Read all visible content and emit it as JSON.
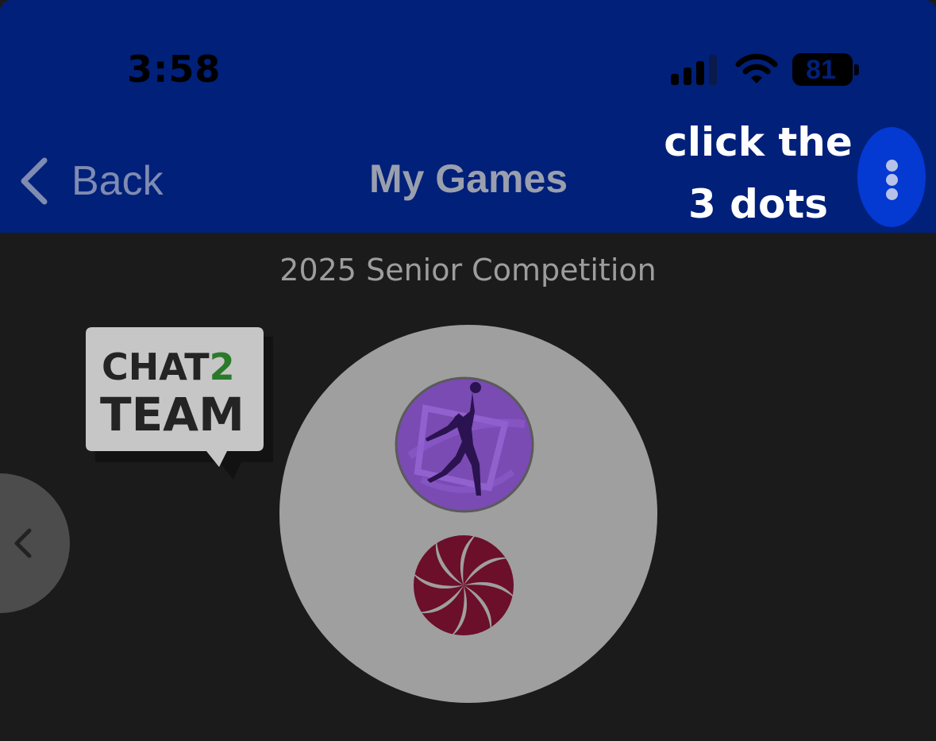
{
  "status_bar": {
    "time": "3:58",
    "battery_level": "81",
    "signal_bars_active": 3,
    "signal_bars_total": 4,
    "icons": [
      "signal-icon",
      "wifi-icon",
      "battery-icon"
    ]
  },
  "nav": {
    "back_label": "Back",
    "title": "My Games",
    "back_icon": "chevron-left-icon",
    "menu_icon": "more-vertical-icon"
  },
  "hint": {
    "line1": "click the",
    "line2": "3 dots"
  },
  "main": {
    "competition_name": "2025 Senior Competition",
    "chat_logo": {
      "word1_a": "CHAT",
      "word1_b": "2",
      "word2": "TEAM"
    },
    "prev_icon": "chevron-left-icon",
    "team_logos": [
      "netball-player-logo",
      "swirl-logo"
    ]
  },
  "colors": {
    "header_bg": "#01207a",
    "body_bg": "#1b1b1b",
    "menu_button": "#0439d2",
    "game_circle": "#9f9f9f",
    "chat_accent": "#2b7a2b",
    "team1_purple": "#7a4bb3",
    "team2_maroon": "#6b0f2a"
  }
}
